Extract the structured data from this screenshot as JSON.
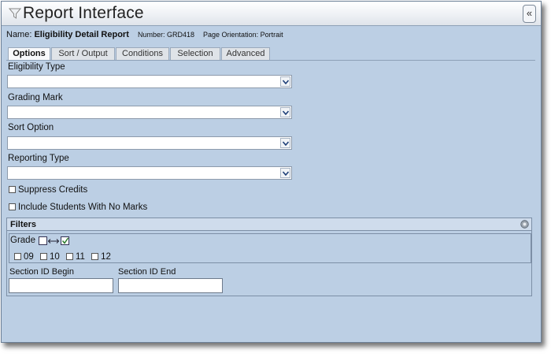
{
  "window": {
    "title": "Report Interface",
    "collapse_glyph": "«"
  },
  "report": {
    "name_label": "Name:",
    "name_value": "Eligibility Detail Report",
    "number": "Number: GRD418",
    "orientation": "Page Orientation: Portrait"
  },
  "tabs": [
    {
      "label": "Options",
      "active": true
    },
    {
      "label": "Sort / Output",
      "active": false
    },
    {
      "label": "Conditions",
      "active": false
    },
    {
      "label": "Selection",
      "active": false
    },
    {
      "label": "Advanced",
      "active": false
    }
  ],
  "fields": [
    {
      "label": "Eligibility Type",
      "value": ""
    },
    {
      "label": "Grading Mark",
      "value": ""
    },
    {
      "label": "Sort Option",
      "value": ""
    },
    {
      "label": "Reporting Type",
      "value": ""
    }
  ],
  "checkboxes": [
    {
      "label": "Suppress Credits",
      "checked": false
    },
    {
      "label": "Include Students With No Marks",
      "checked": false
    }
  ],
  "filters": {
    "title": "Filters",
    "grade_label": "Grade",
    "grade_options": [
      "09",
      "10",
      "11",
      "12"
    ],
    "section_begin_label": "Section ID Begin",
    "section_end_label": "Section ID End",
    "section_begin_value": "",
    "section_end_value": ""
  },
  "icons": {
    "title": "filter-funnel-icon",
    "collapse": "double-chevron-left-icon",
    "dropdown": "chevron-down-icon",
    "filters": "circle-toggle-icon",
    "grade_toggle": "checkbox-toggle-icon"
  }
}
